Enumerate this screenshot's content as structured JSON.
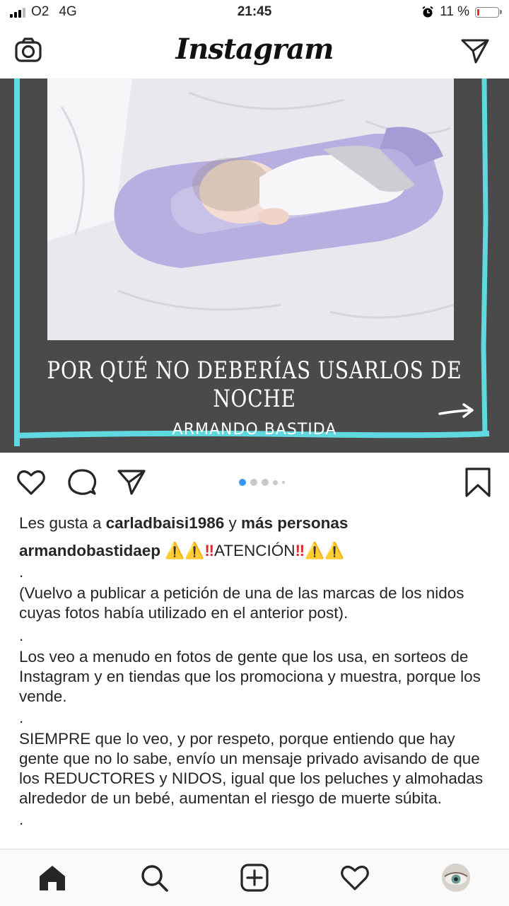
{
  "status_bar": {
    "carrier": "O2",
    "network": "4G",
    "time": "21:45",
    "battery_percent": "11 %",
    "battery_level": 0.11
  },
  "header": {
    "app_title": "Instagram",
    "camera_icon": "camera-icon",
    "direct_icon": "paper-plane-icon"
  },
  "post": {
    "image_title": "POR QUÉ NO DEBERÍAS USARLOS DE NOCHE",
    "image_author": "ARMANDO BASTIDA",
    "carousel_dots": 5,
    "carousel_active": 0,
    "likes": {
      "prefix": "Les gusta a",
      "user": "carladbaisi1986",
      "conjunction": "y",
      "others": "más personas"
    },
    "author": "armandobastidaep",
    "headline": "ATENCIÓN",
    "caption_lines": [
      ".",
      "(Vuelvo a publicar a petición de una de las marcas de los nidos cuyas fotos había utilizado en el anterior post).",
      ".",
      "Los veo a menudo en fotos de gente que los usa, en sorteos de Instagram y en tiendas que los promociona y muestra, porque los vende.",
      ".",
      "SIEMPRE que lo veo, y por respeto, porque entiendo que hay gente que no lo sabe, envío un mensaje privado avisando de que los REDUCTORES y NIDOS, igual que los peluches y almohadas alrededor de un bebé, aumentan el riesgo de muerte súbita.",
      "."
    ]
  },
  "colors": {
    "accent_blue": "#3897f0",
    "frame_cyan": "#5fd8e0",
    "image_bg": "#4a4a4a",
    "pillow_lilac": "#b9aee0"
  }
}
